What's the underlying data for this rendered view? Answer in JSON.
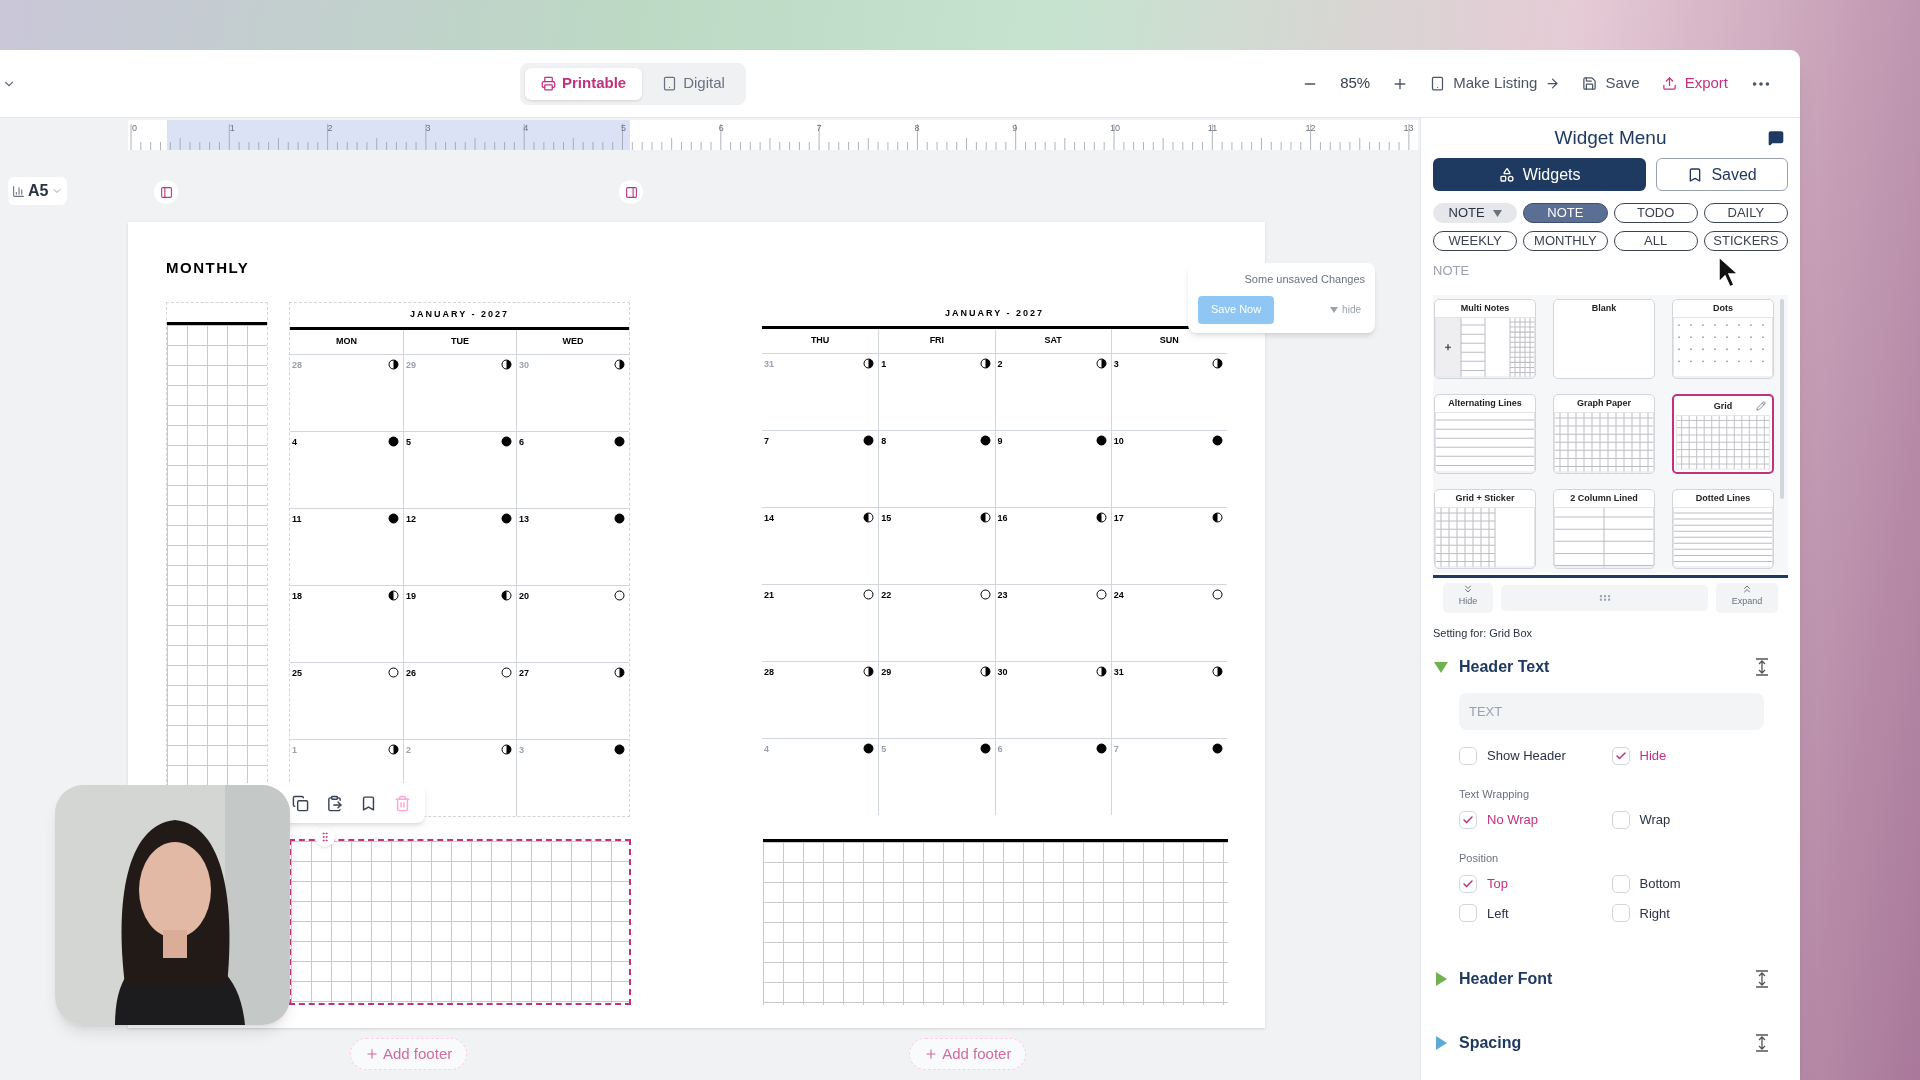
{
  "toolbar": {
    "modes": [
      {
        "label": "Printable",
        "selected": true
      },
      {
        "label": "Digital",
        "selected": false
      }
    ],
    "zoom": "85%",
    "actions": [
      {
        "kind": "listing",
        "label": "Make Listing"
      },
      {
        "kind": "save",
        "label": "Save"
      },
      {
        "kind": "export",
        "label": "Export"
      }
    ]
  },
  "ruler": {
    "labels": [
      "0",
      "1",
      "2",
      "3",
      "4",
      "5",
      "6",
      "7",
      "8",
      "9",
      "10",
      "11",
      "12",
      "13"
    ]
  },
  "page_size": "A5",
  "unsaved_popup": {
    "message": "Some unsaved Changes",
    "button": "Save Now",
    "hide": "hide"
  },
  "page": {
    "title": "MONTHLY",
    "calendars": [
      {
        "heading": "JANUARY - 2027",
        "weekdays": [
          "MON",
          "TUE",
          "WED"
        ],
        "weeks": [
          [
            {
              "day": "28",
              "muted": true,
              "kind": "dark_right"
            },
            {
              "day": "29",
              "muted": true,
              "kind": "dark_right"
            },
            {
              "day": "30",
              "muted": true,
              "kind": "dark_right"
            }
          ],
          [
            {
              "day": "4",
              "muted": false,
              "kind": "new"
            },
            {
              "day": "5",
              "muted": false,
              "kind": "new"
            },
            {
              "day": "6",
              "muted": false,
              "kind": "new"
            }
          ],
          [
            {
              "day": "11",
              "muted": false,
              "kind": "new"
            },
            {
              "day": "12",
              "muted": false,
              "kind": "new"
            },
            {
              "day": "13",
              "muted": false,
              "kind": "new"
            }
          ],
          [
            {
              "day": "18",
              "muted": false,
              "kind": "dark_left"
            },
            {
              "day": "19",
              "muted": false,
              "kind": "dark_left"
            },
            {
              "day": "20",
              "muted": false,
              "kind": "full"
            }
          ],
          [
            {
              "day": "25",
              "muted": false,
              "kind": "full"
            },
            {
              "day": "26",
              "muted": false,
              "kind": "full"
            },
            {
              "day": "27",
              "muted": false,
              "kind": "dark_right"
            }
          ],
          [
            {
              "day": "1",
              "muted": true,
              "kind": "dark_right"
            },
            {
              "day": "2",
              "muted": true,
              "kind": "dark_right"
            },
            {
              "day": "3",
              "muted": true,
              "kind": "new"
            }
          ]
        ]
      },
      {
        "heading": "JANUARY - 2027",
        "weekdays": [
          "THU",
          "FRI",
          "SAT",
          "SUN"
        ],
        "weeks": [
          [
            {
              "day": "31",
              "muted": true,
              "kind": "dark_right"
            },
            {
              "day": "1",
              "muted": false,
              "kind": "dark_right"
            },
            {
              "day": "2",
              "muted": false,
              "kind": "dark_right"
            },
            {
              "day": "3",
              "muted": false,
              "kind": "dark_right"
            }
          ],
          [
            {
              "day": "7",
              "muted": false,
              "kind": "new"
            },
            {
              "day": "8",
              "muted": false,
              "kind": "new"
            },
            {
              "day": "9",
              "muted": false,
              "kind": "new"
            },
            {
              "day": "10",
              "muted": false,
              "kind": "new"
            }
          ],
          [
            {
              "day": "14",
              "muted": false,
              "kind": "dark_left"
            },
            {
              "day": "15",
              "muted": false,
              "kind": "dark_left"
            },
            {
              "day": "16",
              "muted": false,
              "kind": "dark_left"
            },
            {
              "day": "17",
              "muted": false,
              "kind": "dark_left"
            }
          ],
          [
            {
              "day": "21",
              "muted": false,
              "kind": "full"
            },
            {
              "day": "22",
              "muted": false,
              "kind": "full"
            },
            {
              "day": "23",
              "muted": false,
              "kind": "full"
            },
            {
              "day": "24",
              "muted": false,
              "kind": "full"
            }
          ],
          [
            {
              "day": "28",
              "muted": false,
              "kind": "dark_right"
            },
            {
              "day": "29",
              "muted": false,
              "kind": "dark_right"
            },
            {
              "day": "30",
              "muted": false,
              "kind": "dark_right"
            },
            {
              "day": "31",
              "muted": false,
              "kind": "dark_right"
            }
          ],
          [
            {
              "day": "4",
              "muted": true,
              "kind": "new"
            },
            {
              "day": "5",
              "muted": true,
              "kind": "new"
            },
            {
              "day": "6",
              "muted": true,
              "kind": "new"
            },
            {
              "day": "7",
              "muted": true,
              "kind": "new"
            }
          ]
        ]
      }
    ]
  },
  "footers": [
    "Add footer",
    "Add footer"
  ],
  "widget_menu": {
    "title": "Widget Menu",
    "tabs": [
      {
        "kind": "widgets",
        "label": "Widgets",
        "selected": true
      },
      {
        "kind": "saved",
        "label": "Saved",
        "selected": false
      }
    ],
    "chips": [
      {
        "kind": "dropdown",
        "label": "NOTE",
        "selected": false
      },
      {
        "kind": "filter",
        "label": "NOTE",
        "selected": true
      },
      {
        "kind": "filter",
        "label": "TODO",
        "selected": false
      },
      {
        "kind": "filter",
        "label": "DAILY",
        "selected": false
      },
      {
        "kind": "filter",
        "label": "WEEKLY",
        "selected": false
      },
      {
        "kind": "filter",
        "label": "MONTHLY",
        "selected": false
      },
      {
        "kind": "filter",
        "label": "ALL",
        "selected": false
      },
      {
        "kind": "filter",
        "label": "STICKERS",
        "selected": false
      }
    ],
    "section": "NOTE",
    "cards": [
      {
        "kind": "multi",
        "title": "Multi Notes",
        "selected": false
      },
      {
        "kind": "blank",
        "title": "Blank",
        "selected": false
      },
      {
        "kind": "dots",
        "title": "Dots",
        "selected": false
      },
      {
        "kind": "lines",
        "title": "Alternating Lines",
        "selected": false
      },
      {
        "kind": "graph",
        "title": "Graph Paper",
        "selected": false
      },
      {
        "kind": "grid",
        "title": "Grid",
        "selected": true
      },
      {
        "kind": "grid_sticker",
        "title": "Grid + Sticker",
        "selected": false
      },
      {
        "kind": "two_column",
        "title": "2 Column Lined",
        "selected": false
      },
      {
        "kind": "dotted_lines",
        "title": "Dotted Lines",
        "selected": false
      }
    ],
    "hide": "Hide",
    "expand": "Expand"
  },
  "settings": {
    "target": "Setting for: Grid Box",
    "sections": [
      {
        "title": "Header Text",
        "expanded": true,
        "color": "#72b150",
        "placeholder": "TEXT",
        "groups": [
          {
            "options": [
              {
                "label": "Show Header",
                "checked": false
              },
              {
                "label": "Hide",
                "checked": true
              }
            ]
          },
          {
            "label": "Text Wrapping",
            "options": [
              {
                "label": "No Wrap",
                "checked": true
              },
              {
                "label": "Wrap",
                "checked": false
              }
            ]
          },
          {
            "label": "Position",
            "options": [
              {
                "label": "Top",
                "checked": true
              },
              {
                "label": "Bottom",
                "checked": false
              },
              {
                "label": "Left",
                "checked": false
              },
              {
                "label": "Right",
                "checked": false
              }
            ]
          }
        ]
      },
      {
        "title": "Header Font",
        "expanded": false,
        "color": "#72b150"
      },
      {
        "title": "Spacing",
        "expanded": false,
        "color": "#5daad6"
      }
    ]
  }
}
